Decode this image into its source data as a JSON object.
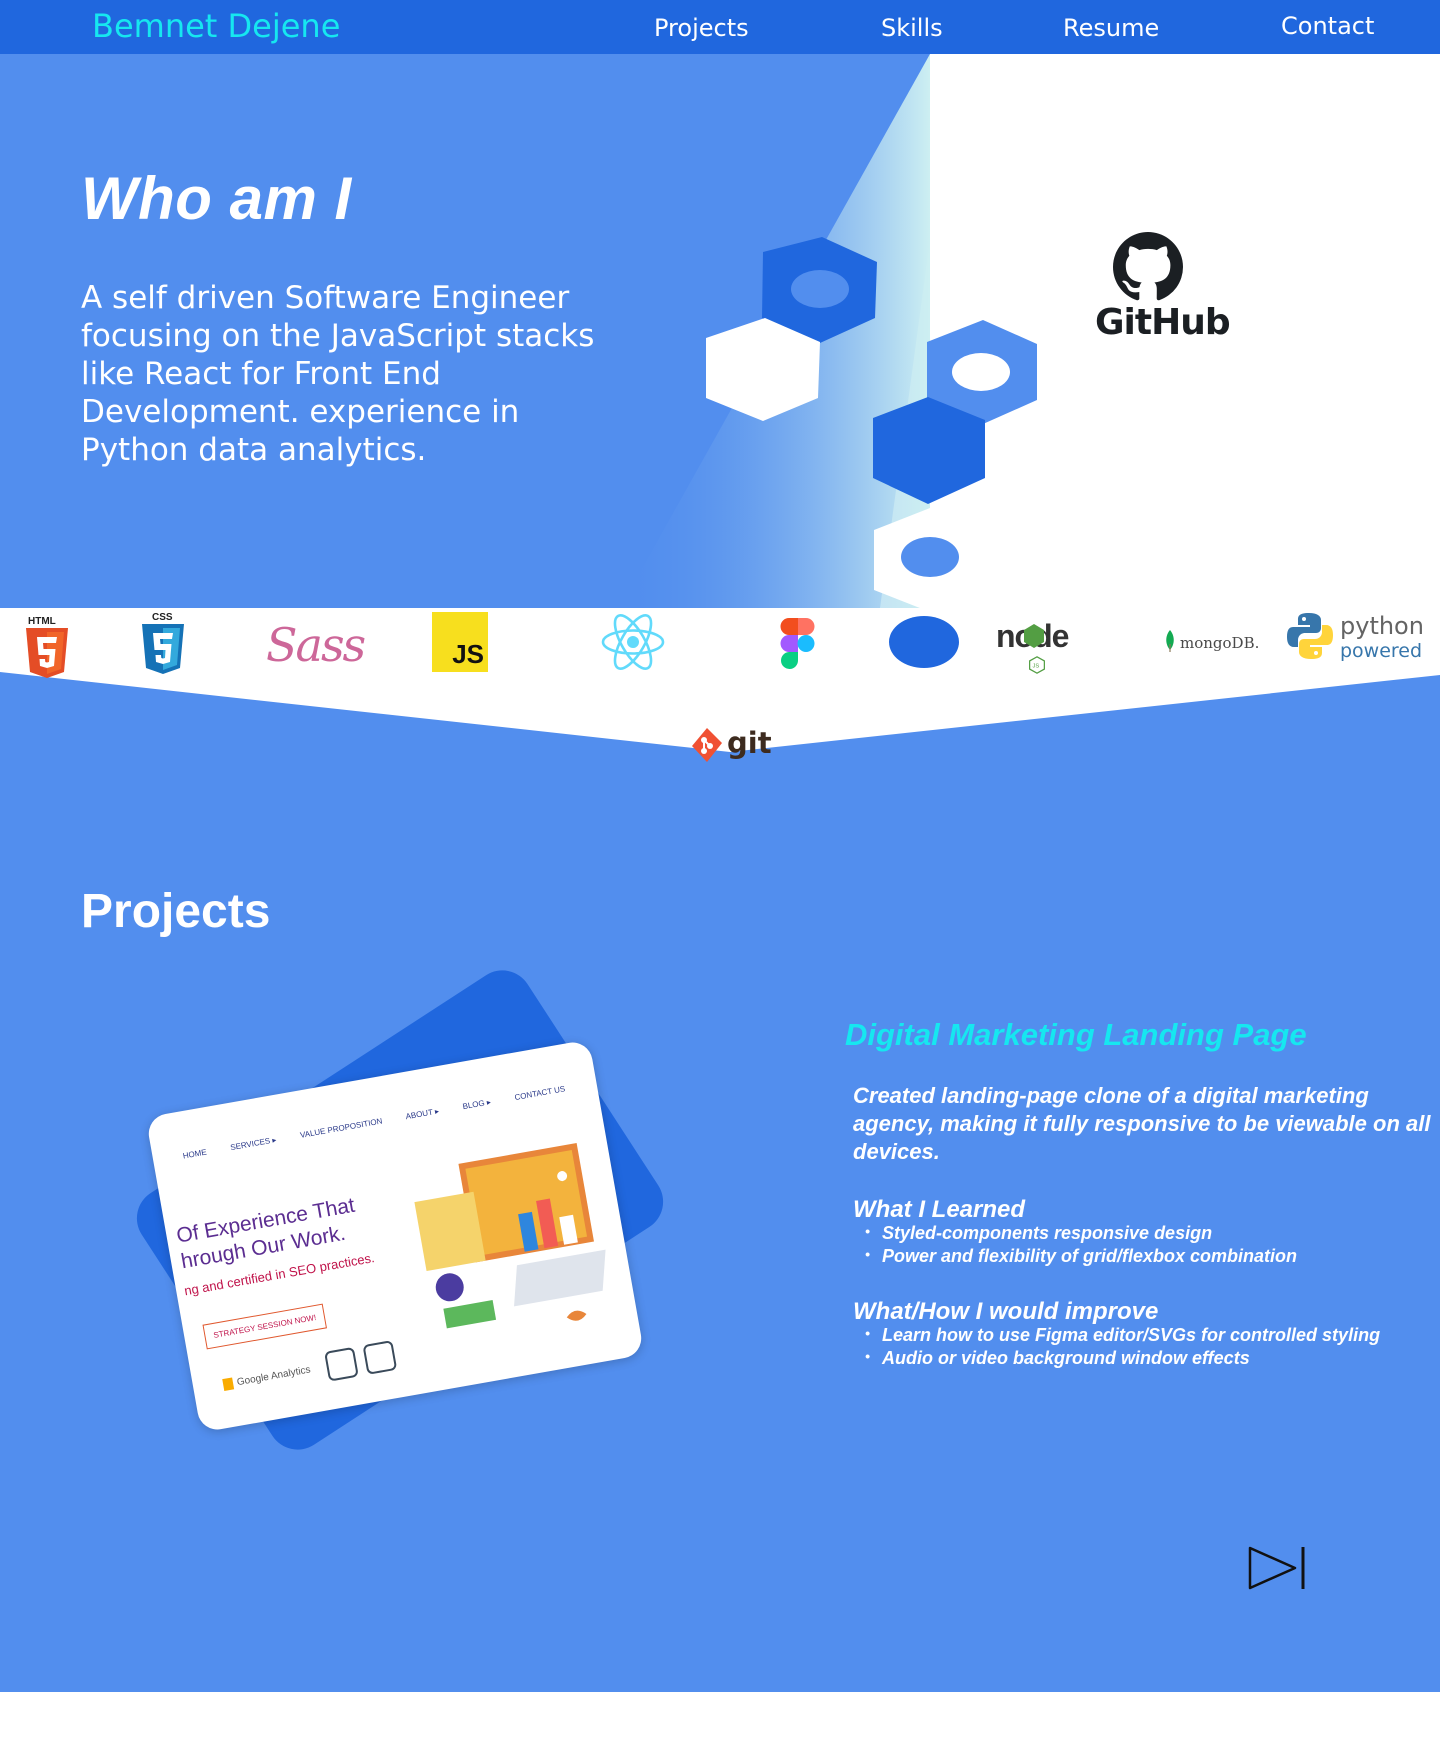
{
  "header": {
    "brand": "Bemnet Dejene",
    "nav": [
      {
        "label": "Projects"
      },
      {
        "label": "Skills"
      },
      {
        "label": "Resume"
      },
      {
        "label": "Contact"
      }
    ]
  },
  "hero": {
    "title": "Who am I",
    "text": "A self driven Software Engineer focusing on the JavaScript stacks like React for Front End Development.  experience in Python data analytics.",
    "github_label": "GitHub"
  },
  "skills": {
    "html_label": "HTML",
    "css_label": "CSS",
    "sass_label": "Sass",
    "js_label": "JS",
    "node_label": "node",
    "mongo_label": "mongoDB.",
    "python_label": "python",
    "python_sub": "powered",
    "git_label": "git"
  },
  "projects": {
    "title": "Projects",
    "preview": {
      "nav": [
        "HOME",
        "SERVICES ▸",
        "VALUE PROPOSITION",
        "ABOUT ▸",
        "BLOG ▸",
        "CONTACT US"
      ],
      "headline": "Of Experience That hrough Our Work.",
      "subline": "ng and certified in SEO practices.",
      "button": "STRATEGY SESSION NOW!",
      "badge": "Google Analytics"
    },
    "items": [
      {
        "name": "Digital Marketing Landing Page",
        "description": "Created landing-page clone of a digital marketing agency, making it fully responsive to be viewable on all devices.",
        "learned_title": "What I Learned",
        "learned": [
          "Styled-components responsive design",
          "Power and flexibility of grid/flexbox combination"
        ],
        "improve_title": "What/How I would improve",
        "improve": [
          "Learn how to use Figma editor/SVGs for controlled styling",
          "Audio or video background window effects"
        ]
      }
    ]
  },
  "colors": {
    "header": "#2067DE",
    "brand": "#16E7F0",
    "main_blue": "#528EEE",
    "dark_blue": "#2067DE"
  }
}
